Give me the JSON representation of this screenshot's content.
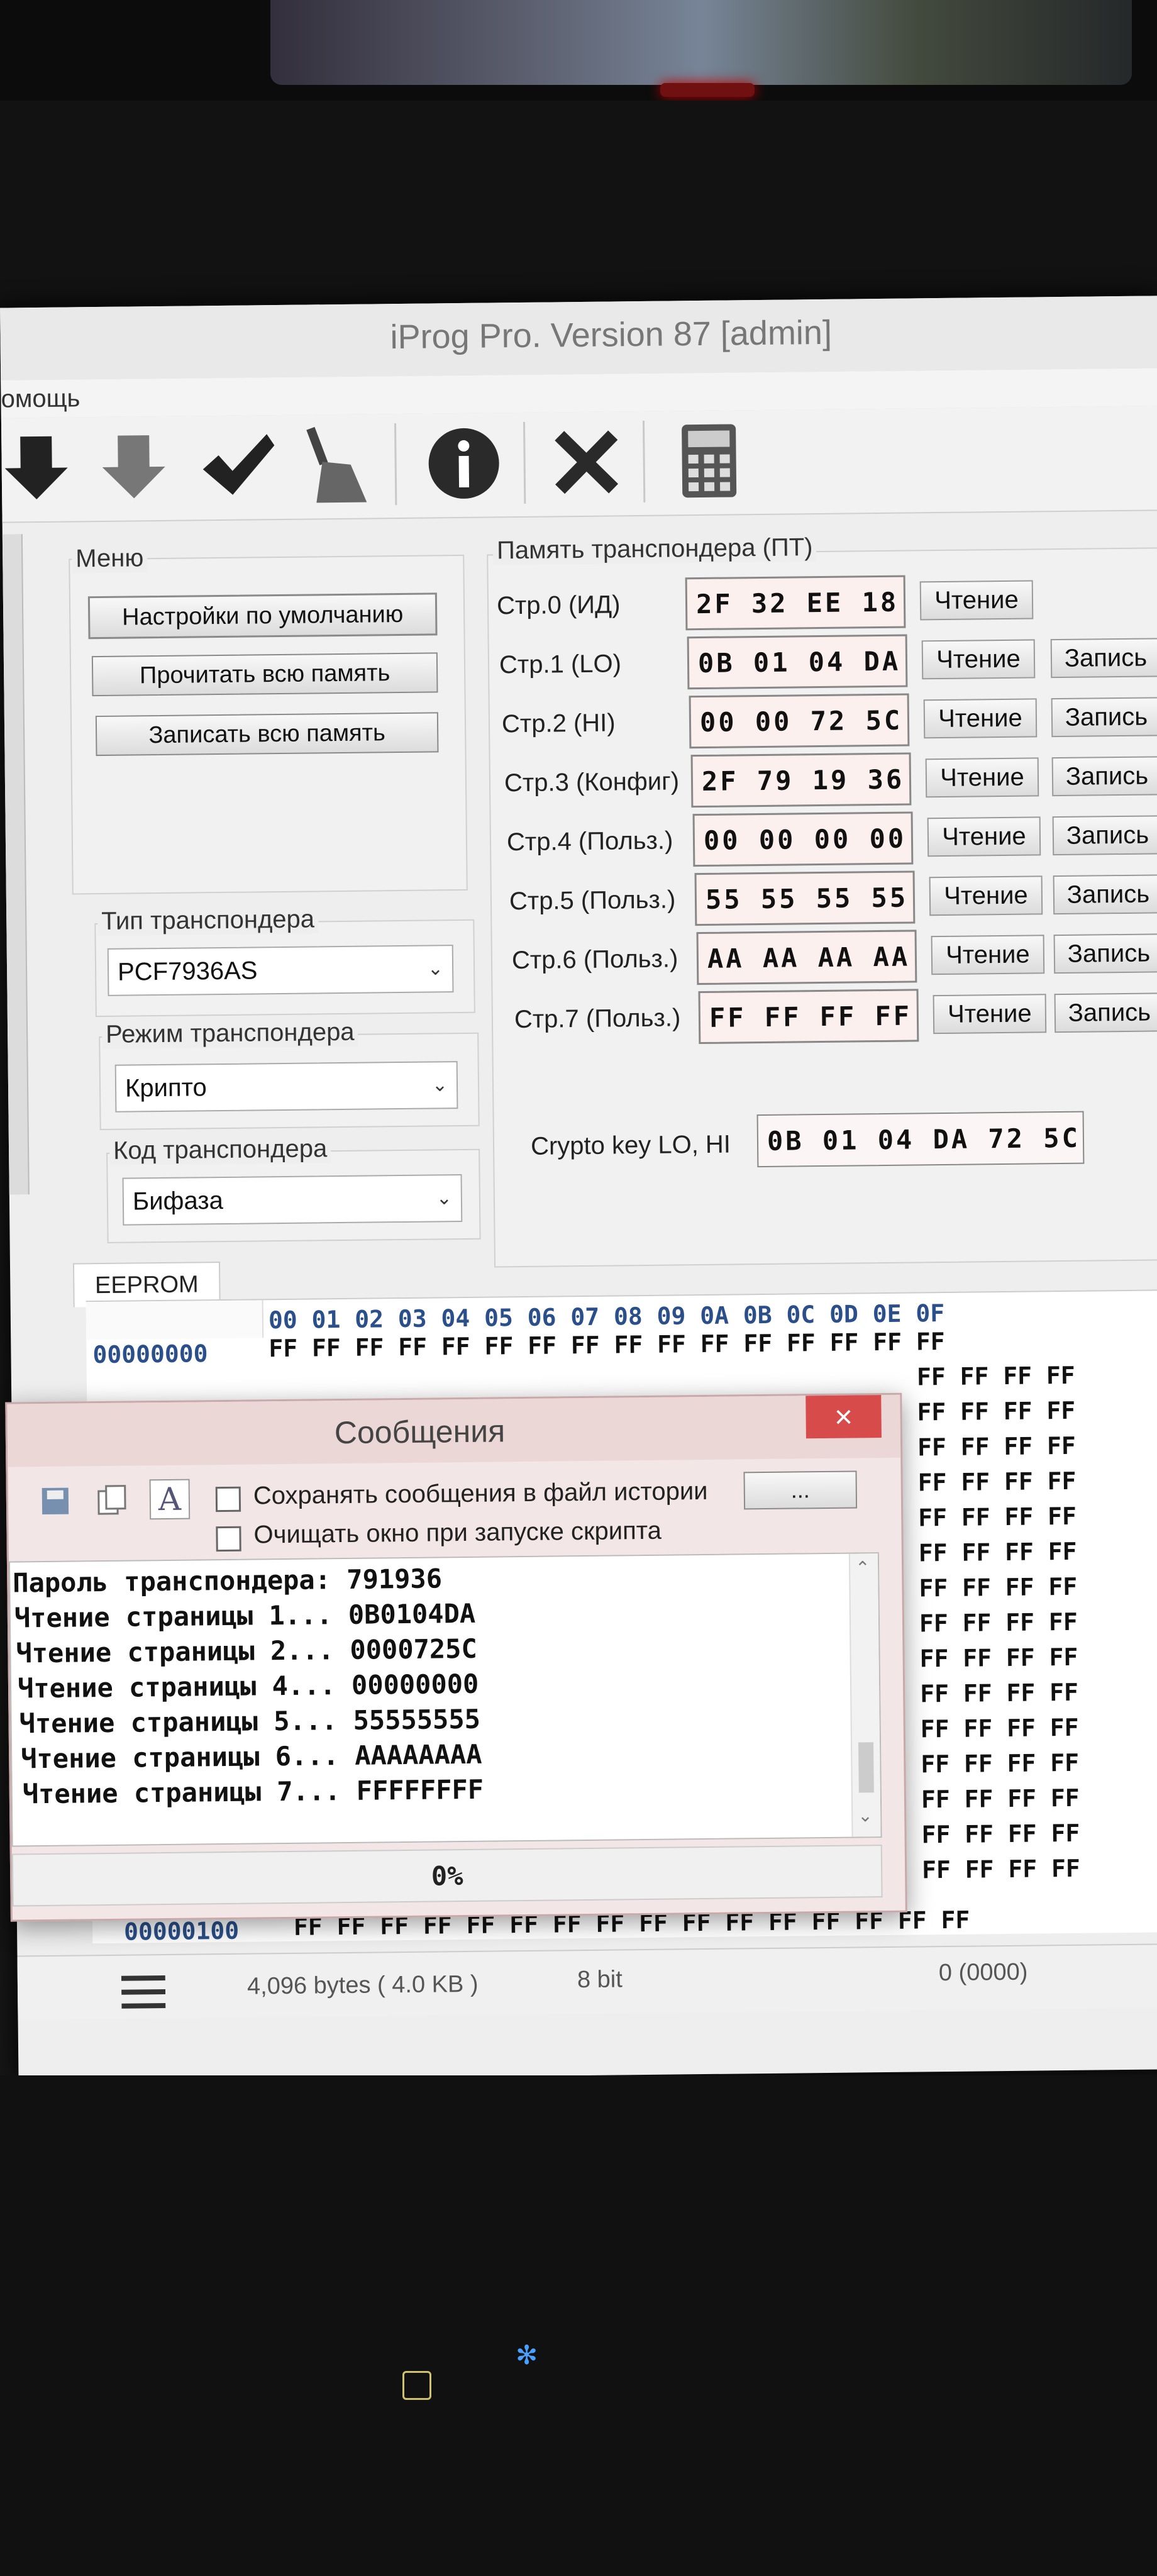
{
  "window": {
    "title": "iProg Pro. Version 87 [admin]"
  },
  "menubar": {
    "help": "омощь"
  },
  "menu_group": {
    "label": "Меню",
    "default_settings": "Настройки по умолчанию",
    "read_all": "Прочитать всю память",
    "write_all": "Записать всю память"
  },
  "transponder": {
    "type_label": "Тип транспондера",
    "type_value": "PCF7936AS",
    "mode_label": "Режим транспондера",
    "mode_value": "Крипто",
    "code_label": "Код транспондера",
    "code_value": "Бифаза"
  },
  "memory": {
    "label": "Память транспондера (ПТ)",
    "read_label": "Чтение",
    "write_label": "Запись",
    "pages": [
      {
        "name": "Стр.0 (ИД)",
        "value": "2F 32 EE 18"
      },
      {
        "name": "Стр.1 (LO)",
        "value": "0B 01 04 DA"
      },
      {
        "name": "Стр.2 (HI)",
        "value": "00 00 72 5C"
      },
      {
        "name": "Стр.3 (Конфиг)",
        "value": "2F 79 19 36"
      },
      {
        "name": "Стр.4 (Польз.)",
        "value": "00 00 00 00"
      },
      {
        "name": "Стр.5 (Польз.)",
        "value": "55 55 55 55"
      },
      {
        "name": "Стр.6 (Польз.)",
        "value": "AA AA AA AA"
      },
      {
        "name": "Стр.7 (Польз.)",
        "value": "FF FF FF FF"
      }
    ],
    "crypto_label": "Crypto key LO, HI",
    "crypto_value": "0B 01 04 DA 72 5C"
  },
  "eeprom": {
    "tab": "EEPROM",
    "header": "00 01 02 03 04 05 06 07 08 09 0A 0B 0C 0D 0E 0F",
    "addr_first": "00000000",
    "addr_last": "00000100",
    "row_full": "FF FF FF FF FF FF FF FF FF FF FF FF FF FF FF FF",
    "row_right": "FF FF FF FF"
  },
  "status": {
    "size": "4,096 bytes ( 4.0 KB )",
    "bits": "8 bit",
    "offset": "0 (0000)"
  },
  "messages": {
    "title": "Сообщения",
    "close": "×",
    "save_history": "Сохранять сообщения в файл истории",
    "browse": "...",
    "clear_on_start": "Очищать окно при запуске скрипта",
    "log": [
      "Пароль транспондера: 791936",
      "Чтение страницы 1... 0B0104DA",
      "Чтение страницы 2... 0000725C",
      "Чтение страницы 4... 00000000",
      "Чтение страницы 5... 55555555",
      "Чтение страницы 6... AAAAAAAA",
      "Чтение страницы 7... FFFFFFFF"
    ],
    "progress": "0%"
  },
  "colors": {
    "accent": "#2a4f8a",
    "close": "#d84b4b",
    "dialog": "#f3e6e6"
  },
  "icons": [
    "arrow-down-icon",
    "arrow-down-icon",
    "checkmark-icon",
    "broom-icon",
    "info-icon",
    "close-x-icon",
    "calculator-icon"
  ]
}
